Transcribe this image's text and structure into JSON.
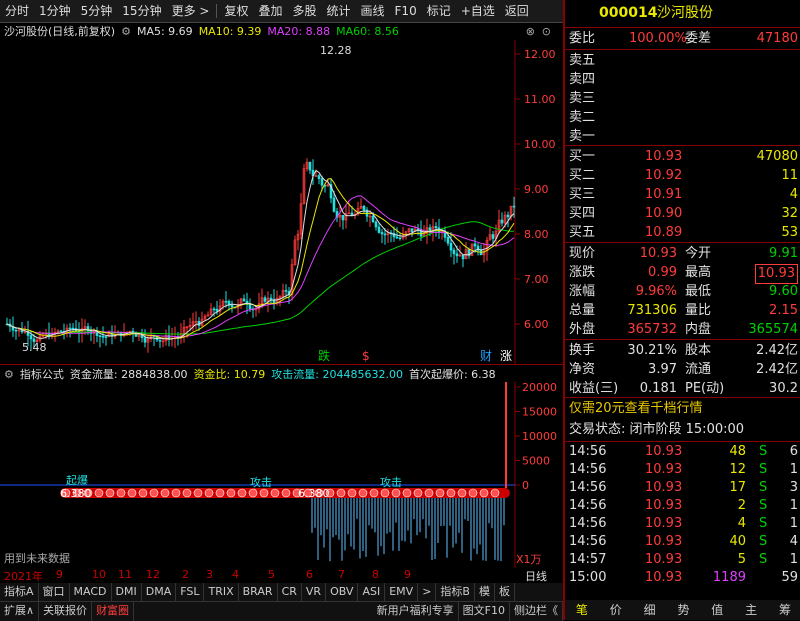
{
  "toolbar": {
    "items": [
      "分时",
      "1分钟",
      "5分钟",
      "15分钟",
      "更多 >",
      "复权",
      "叠加",
      "多股",
      "统计",
      "画线",
      "F10",
      "标记",
      "+自选",
      "返回"
    ]
  },
  "chart_header": {
    "stock": "沙河股份(日线,前复权)",
    "ma5": "MA5: 9.69",
    "ma10": "MA10: 9.39",
    "ma20": "MA20: 8.88",
    "ma60": "MA60: 8.56"
  },
  "price_axis": [
    "12.00",
    "11.00",
    "10.00",
    "9.00",
    "8.00",
    "7.00",
    "6.00"
  ],
  "price_labels": {
    "high": "12.28",
    "low": "5.48"
  },
  "markers": {
    "die": "跌",
    "dollar": "$",
    "cai": "财",
    "zhang": "涨"
  },
  "indicator_header": {
    "name": "指标公式",
    "fund_flow": "资金流量: 2884838.00",
    "fund_ratio": "资金比: 10.79",
    "attack_flow": "攻击流量: 204485632.00",
    "first_burst": "首次起爆价: 6.38"
  },
  "ind_axis": [
    "20000",
    "15000",
    "10000",
    "5000",
    "0"
  ],
  "ind_labels": {
    "qibao": "起爆",
    "gongji": "攻击",
    "price": "6.380",
    "future_data": "用到未来数据",
    "unit": "X1万"
  },
  "time_axis": {
    "year": "2021年",
    "months": [
      "9",
      "10",
      "11",
      "12",
      "2",
      "3",
      "4",
      "5",
      "6",
      "7",
      "8",
      "9"
    ],
    "mode": "日线"
  },
  "tabs": [
    "指标A",
    "窗口",
    "MACD",
    "DMI",
    "DMA",
    "FSL",
    "TRIX",
    "BRAR",
    "CR",
    "VR",
    "OBV",
    "ASI",
    "EMV",
    ">",
    "指标B",
    "模",
    "板"
  ],
  "bottom_tabs": [
    "扩展∧",
    "关联报价",
    "财富圈"
  ],
  "bottom_right": [
    "新用户福利专享",
    "图文F10",
    "侧边栏《"
  ],
  "quote": {
    "code": "000014",
    "name": "沙河股份",
    "weibi_label": "委比",
    "weibi": "100.00%",
    "weicha_label": "委差",
    "weicha": "47180",
    "sell": [
      {
        "label": "卖五"
      },
      {
        "label": "卖四"
      },
      {
        "label": "卖三"
      },
      {
        "label": "卖二"
      },
      {
        "label": "卖一"
      }
    ],
    "buy": [
      {
        "label": "买一",
        "price": "10.93",
        "vol": "47080"
      },
      {
        "label": "买二",
        "price": "10.92",
        "vol": "11"
      },
      {
        "label": "买三",
        "price": "10.91",
        "vol": "4"
      },
      {
        "label": "买四",
        "price": "10.90",
        "vol": "32"
      },
      {
        "label": "买五",
        "price": "10.89",
        "vol": "53"
      }
    ],
    "stats": [
      {
        "l1": "现价",
        "v1": "10.93",
        "l2": "今开",
        "v2": "9.91"
      },
      {
        "l1": "涨跌",
        "v1": "0.99",
        "l2": "最高",
        "v2": "10.93"
      },
      {
        "l1": "涨幅",
        "v1": "9.96%",
        "l2": "最低",
        "v2": "9.60"
      },
      {
        "l1": "总量",
        "v1": "731306",
        "l2": "量比",
        "v2": "2.15"
      },
      {
        "l1": "外盘",
        "v1": "365732",
        "l2": "内盘",
        "v2": "365574"
      }
    ],
    "stats2": [
      {
        "l1": "换手",
        "v1": "30.21%",
        "l2": "股本",
        "v2": "2.42亿"
      },
      {
        "l1": "净资",
        "v1": "3.97",
        "l2": "流通",
        "v2": "2.42亿"
      },
      {
        "l1": "收益(三)",
        "v1": "0.181",
        "l2": "PE(动)",
        "v2": "30.2"
      }
    ],
    "promo": "仅需20元查看千档行情",
    "status": "交易状态: 闭市阶段 15:00:00",
    "ticks": [
      {
        "t": "14:56",
        "p": "10.93",
        "v": "48",
        "s": "S",
        "n": "6"
      },
      {
        "t": "14:56",
        "p": "10.93",
        "v": "12",
        "s": "S",
        "n": "1"
      },
      {
        "t": "14:56",
        "p": "10.93",
        "v": "17",
        "s": "S",
        "n": "3"
      },
      {
        "t": "14:56",
        "p": "10.93",
        "v": "2",
        "s": "S",
        "n": "1"
      },
      {
        "t": "14:56",
        "p": "10.93",
        "v": "4",
        "s": "S",
        "n": "1"
      },
      {
        "t": "14:56",
        "p": "10.93",
        "v": "40",
        "s": "S",
        "n": "4"
      },
      {
        "t": "14:57",
        "p": "10.93",
        "v": "5",
        "s": "S",
        "n": "1"
      },
      {
        "t": "15:00",
        "p": "10.93",
        "v": "1189",
        "s": "",
        "n": "59"
      }
    ],
    "bottom": [
      "笔",
      "价",
      "细",
      "势",
      "值",
      "主",
      "筹"
    ]
  }
}
